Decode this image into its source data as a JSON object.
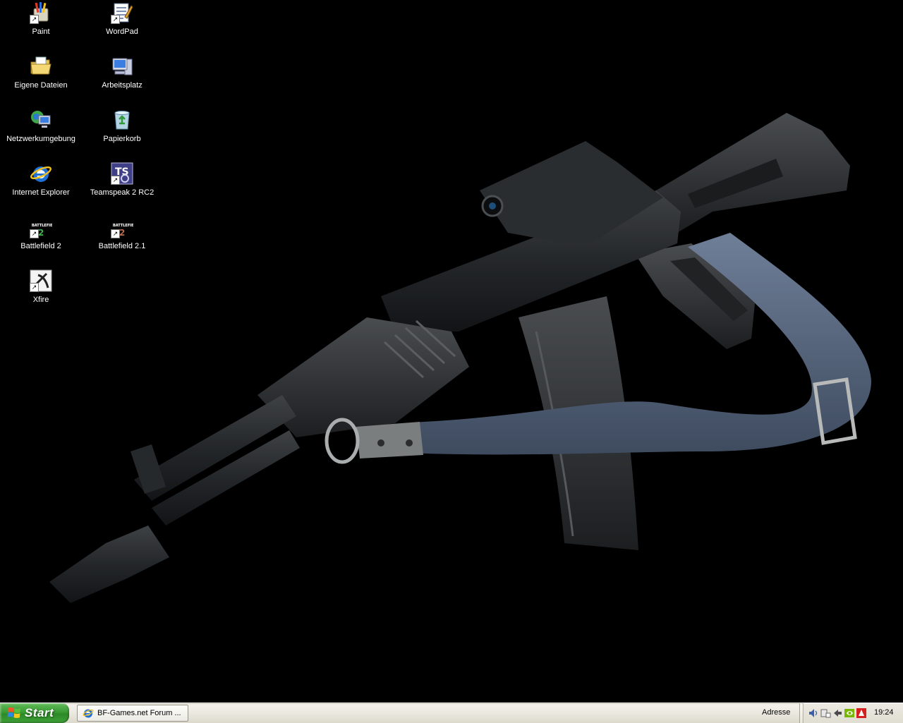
{
  "desktop": {
    "icons": [
      {
        "label": "Paint",
        "icon": "paint-icon",
        "shortcut": true
      },
      {
        "label": "WordPad",
        "icon": "wordpad-icon",
        "shortcut": true
      },
      {
        "label": "Eigene Dateien",
        "icon": "my-documents-icon",
        "shortcut": false
      },
      {
        "label": "Arbeitsplatz",
        "icon": "my-computer-icon",
        "shortcut": false
      },
      {
        "label": "Netzwerkumgebung",
        "icon": "network-places-icon",
        "shortcut": false
      },
      {
        "label": "Papierkorb",
        "icon": "recycle-bin-icon",
        "shortcut": false
      },
      {
        "label": "Internet Explorer",
        "icon": "internet-explorer-icon",
        "shortcut": false
      },
      {
        "label": "Teamspeak 2 RC2",
        "icon": "teamspeak-icon",
        "shortcut": true
      },
      {
        "label": "Battlefield 2",
        "icon": "battlefield-2-icon",
        "shortcut": true
      },
      {
        "label": "Battlefield 2.1",
        "icon": "battlefield-2-1-icon",
        "shortcut": true
      },
      {
        "label": "Xfire",
        "icon": "xfire-icon",
        "shortcut": true
      }
    ],
    "wallpaper": "rifle-wallpaper"
  },
  "taskbar": {
    "start_label": "Start",
    "task_button_label": "BF-Games.net Forum ...",
    "address_label": "Adresse",
    "clock": "19:24"
  },
  "colors": {
    "desktop_bg": "#000000",
    "start_green": "#3a9a33",
    "taskbar_bg": "#ebe9e0"
  }
}
